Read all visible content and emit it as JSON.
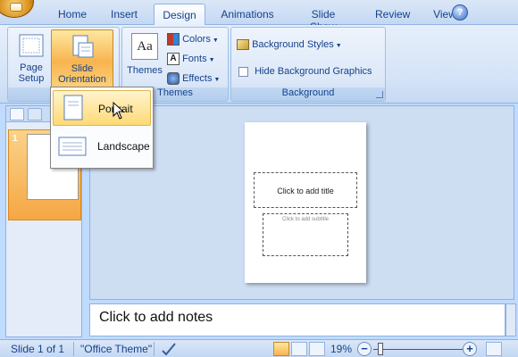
{
  "ribbon_tabs": [
    "Home",
    "Insert",
    "Design",
    "Animations",
    "Slide Show",
    "Review",
    "View"
  ],
  "help_glyph": "?",
  "page_setup_group": {
    "page_setup_label": "Page Setup",
    "slide_orientation_label": "Slide Orientation",
    "group_label": "Pa"
  },
  "themes_group": {
    "themes_label": "Themes",
    "colors_label": "Colors",
    "fonts_label": "Fonts",
    "effects_label": "Effects",
    "group_label": "Themes",
    "themes_icon_text": "Aa"
  },
  "background_group": {
    "background_styles_label": "Background Styles",
    "hide_bg_graphics_label": "Hide Background Graphics",
    "hide_bg_graphics_checked": false,
    "group_label": "Background"
  },
  "orientation_menu": [
    {
      "label": "Portrait",
      "hovered": true,
      "icon": "portrait-page-icon"
    },
    {
      "label": "Landscape",
      "hovered": false,
      "icon": "landscape-page-icon"
    }
  ],
  "thumbnails": [
    {
      "number": "1",
      "selected": true
    }
  ],
  "slide": {
    "title_placeholder": "Click to add title",
    "subtitle_placeholder": "Click to add subtitle"
  },
  "notes_placeholder": "Click to add notes",
  "status_bar": {
    "slide_info": "Slide 1 of 1",
    "theme_name": "\"Office Theme\"",
    "zoom_level": "19%",
    "zoom_out_glyph": "−",
    "zoom_in_glyph": "+"
  },
  "colors": {
    "accent_orange": "#f8b44f",
    "ribbon_blue": "#dbe7f7",
    "text_blue": "#15428b"
  }
}
